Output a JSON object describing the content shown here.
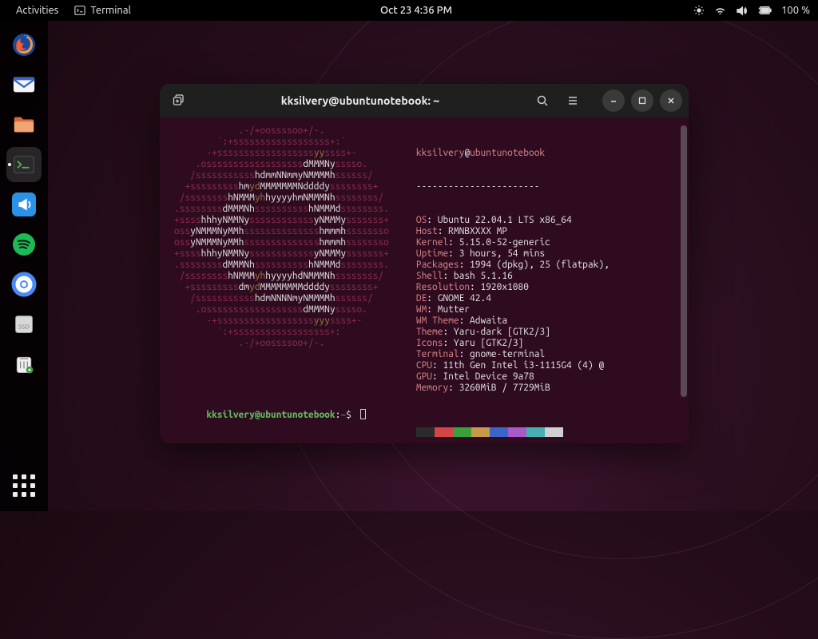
{
  "topbar": {
    "activities": "Activities",
    "app_label": "Terminal",
    "clock": "Oct 23  4:36 PM",
    "battery": "100 %"
  },
  "dock": {
    "items": [
      {
        "name": "firefox",
        "bg": "#1a4a9a",
        "glyph": "firefox"
      },
      {
        "name": "mail",
        "bg": "#3a67c7",
        "glyph": "mail"
      },
      {
        "name": "files",
        "bg": "#d96a3b",
        "glyph": "files"
      },
      {
        "name": "terminal",
        "bg": "#3a3a3a",
        "glyph": "term",
        "active": true
      },
      {
        "name": "megaphone",
        "bg": "#2a93e8",
        "glyph": "mega"
      },
      {
        "name": "spotify",
        "bg": "#1db954",
        "glyph": "spot"
      },
      {
        "name": "chromium",
        "bg": "#4a8af4",
        "glyph": "chrome"
      },
      {
        "name": "ssd",
        "bg": "#cfcfcf",
        "glyph": "drive"
      },
      {
        "name": "trash",
        "bg": "#f0f0f0",
        "glyph": "trash"
      }
    ]
  },
  "window": {
    "title": "kksilvery@ubuntunotebook: ~"
  },
  "neofetch": {
    "user": "kksilvery",
    "host": "ubuntunotebook",
    "sep": "-----------------------",
    "rows": [
      {
        "k": "OS",
        "v": "Ubuntu 22.04.1 LTS x86_64"
      },
      {
        "k": "Host",
        "v": "RMNBXXXX MP"
      },
      {
        "k": "Kernel",
        "v": "5.15.0-52-generic"
      },
      {
        "k": "Uptime",
        "v": "3 hours, 54 mins"
      },
      {
        "k": "Packages",
        "v": "1994 (dpkg), 25 (flatpak),"
      },
      {
        "k": "Shell",
        "v": "bash 5.1.16"
      },
      {
        "k": "Resolution",
        "v": "1920x1080"
      },
      {
        "k": "DE",
        "v": "GNOME 42.4"
      },
      {
        "k": "WM",
        "v": "Mutter"
      },
      {
        "k": "WM Theme",
        "v": "Adwaita"
      },
      {
        "k": "Theme",
        "v": "Yaru-dark [GTK2/3]"
      },
      {
        "k": "Icons",
        "v": "Yaru [GTK2/3]"
      },
      {
        "k": "Terminal",
        "v": "gnome-terminal"
      },
      {
        "k": "CPU",
        "v": "11th Gen Intel i3-1115G4 (4) @"
      },
      {
        "k": "GPU",
        "v": "Intel Device 9a78"
      },
      {
        "k": "Memory",
        "v": "3260MiB / 7729MiB"
      }
    ],
    "palette": [
      "#2b2b2b",
      "#d64545",
      "#3aa03a",
      "#c8994a",
      "#3a66c8",
      "#a85ac8",
      "#45b0b0",
      "#d0d0d0",
      "#888",
      "#f06a6a",
      "#60d060",
      "#e8c068",
      "#6a8af0",
      "#d080f0",
      "#70d8d8",
      "#f8f8f8"
    ]
  },
  "prompt": {
    "user": "kksilvery",
    "host": "ubuntunotebook",
    "path": "~",
    "symbol": "$"
  },
  "logo_lines": [
    [
      [
        "s",
        "            .-/+oossssoo+/-."
      ]
    ],
    [
      [
        "s",
        "        `:+ssssssssssssssssss+:`"
      ]
    ],
    [
      [
        "s",
        "      -+ssssssssssssssssss"
      ],
      [
        "y",
        "yy"
      ],
      [
        "s",
        "ssss+-"
      ]
    ],
    [
      [
        "s",
        "    .ossssssssssssssssss"
      ],
      [
        "w",
        "dMMMNy"
      ],
      [
        "s",
        "sssso."
      ]
    ],
    [
      [
        "s",
        "   /sssssssssss"
      ],
      [
        "w",
        "hdmmNNmmyNMMMMh"
      ],
      [
        "s",
        "ssssss/"
      ]
    ],
    [
      [
        "s",
        "  +sssssssss"
      ],
      [
        "w",
        "hm"
      ],
      [
        "y",
        "yd"
      ],
      [
        "w",
        "MMMMMMMNddddy"
      ],
      [
        "s",
        "ssssssss+"
      ]
    ],
    [
      [
        "s",
        " /ssssssss"
      ],
      [
        "w",
        "hNMMM"
      ],
      [
        "y",
        "yh"
      ],
      [
        "w",
        "hyyyyhmNMMMNh"
      ],
      [
        "s",
        "ssssssss/"
      ]
    ],
    [
      [
        "s",
        ".ssssssss"
      ],
      [
        "w",
        "dMMMNh"
      ],
      [
        "s",
        "ssssssssss"
      ],
      [
        "w",
        "hNMMMd"
      ],
      [
        "s",
        "ssssssss."
      ]
    ],
    [
      [
        "s",
        "+ssss"
      ],
      [
        "w",
        "hhhyNMMNy"
      ],
      [
        "s",
        "ssssssssssss"
      ],
      [
        "w",
        "yNMMMy"
      ],
      [
        "s",
        "sssssss+"
      ]
    ],
    [
      [
        "s",
        "oss"
      ],
      [
        "w",
        "yNMMMNyMMh"
      ],
      [
        "s",
        "ssssssssssssss"
      ],
      [
        "w",
        "hmmmh"
      ],
      [
        "s",
        "ssssssso"
      ]
    ],
    [
      [
        "s",
        "oss"
      ],
      [
        "w",
        "yNMMMNyMMh"
      ],
      [
        "s",
        "ssssssssssssss"
      ],
      [
        "w",
        "hmmmh"
      ],
      [
        "s",
        "ssssssso"
      ]
    ],
    [
      [
        "s",
        "+ssss"
      ],
      [
        "w",
        "hhhyNMMNy"
      ],
      [
        "s",
        "ssssssssssss"
      ],
      [
        "w",
        "yNMMMy"
      ],
      [
        "s",
        "sssssss+"
      ]
    ],
    [
      [
        "s",
        ".ssssssss"
      ],
      [
        "w",
        "dMMMNh"
      ],
      [
        "s",
        "ssssssssss"
      ],
      [
        "w",
        "hNMMMd"
      ],
      [
        "s",
        "ssssssss."
      ]
    ],
    [
      [
        "s",
        " /ssssssss"
      ],
      [
        "w",
        "hNMMM"
      ],
      [
        "y",
        "yh"
      ],
      [
        "w",
        "hyyyyhdNMMMNh"
      ],
      [
        "s",
        "ssssssss/"
      ]
    ],
    [
      [
        "s",
        "  +sssssssss"
      ],
      [
        "w",
        "dm"
      ],
      [
        "y",
        "yd"
      ],
      [
        "w",
        "MMMMMMMMddddy"
      ],
      [
        "s",
        "ssssssss+"
      ]
    ],
    [
      [
        "s",
        "   /sssssssssss"
      ],
      [
        "w",
        "hdmNNNNmyNMMMMh"
      ],
      [
        "s",
        "ssssss/"
      ]
    ],
    [
      [
        "s",
        "    .ossssssssssssssssss"
      ],
      [
        "w",
        "dMMMNy"
      ],
      [
        "s",
        "sssso."
      ]
    ],
    [
      [
        "s",
        "      -+ssssssssssssssssss"
      ],
      [
        "y",
        "yyy"
      ],
      [
        "s",
        "ssss+-"
      ]
    ],
    [
      [
        "s",
        "        `:+ssssssssssssssssss+:`"
      ]
    ],
    [
      [
        "s",
        "            .-/+oossssoo+/-."
      ]
    ]
  ]
}
